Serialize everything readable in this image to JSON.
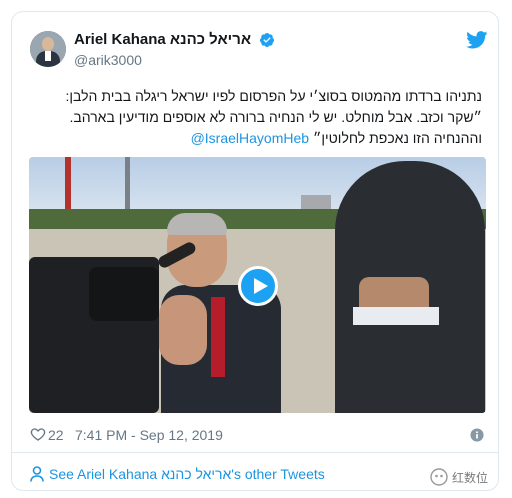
{
  "tweet": {
    "author": {
      "display_name": "Ariel Kahana אריאל כהנא",
      "handle": "@arik3000",
      "verified": true
    },
    "text_lines": [
      "נתניהו ברדתו מהמטוס בסוצ׳י על הפרסום לפיו ישראל ריגלה בבית הלבן:",
      "״שקר וכזב. אבל מוחלט. יש לי הנחיה ברורה לא אוספים מודיעין בארהב.",
      "וההנחיה הזו נאכפת לחלוטין״"
    ],
    "mention": "@IsraelHayomHeb",
    "video": {
      "play_label": "Play video"
    },
    "likes": "22",
    "timestamp": "7:41 PM - Sep 12, 2019",
    "other_tweets_link": "See Ariel Kahana אריאל כהנא's other Tweets"
  },
  "watermark": {
    "text": "红数位"
  },
  "colors": {
    "link": "#1b95e0",
    "twitter_blue": "#1da1f2",
    "secondary_text": "#657786",
    "border": "#e1e8ed"
  },
  "icons": [
    "verified-icon",
    "twitter-logo-icon",
    "play-icon",
    "heart-icon",
    "info-icon",
    "person-icon",
    "watermark-logo-icon"
  ]
}
